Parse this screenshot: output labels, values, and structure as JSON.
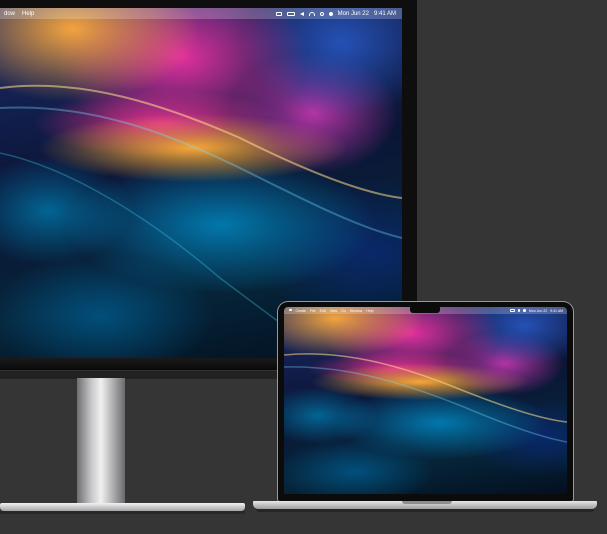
{
  "external_display": {
    "menu_left": [
      "dow",
      "Help"
    ],
    "status": {
      "date": "Mon Jun 22",
      "time": "9:41 AM"
    }
  },
  "laptop": {
    "menu_left": [
      "",
      "Create",
      "File",
      "Edit",
      "View",
      "Go",
      "Window",
      "Help"
    ],
    "status": {
      "date": "Mon Jun 22",
      "time": "9:41 AM"
    }
  },
  "colors": {
    "background": "#353535",
    "wallpaper_accents": [
      "#ffaa3c",
      "#ec30a0",
      "#0096d2",
      "#1b2a68"
    ]
  }
}
